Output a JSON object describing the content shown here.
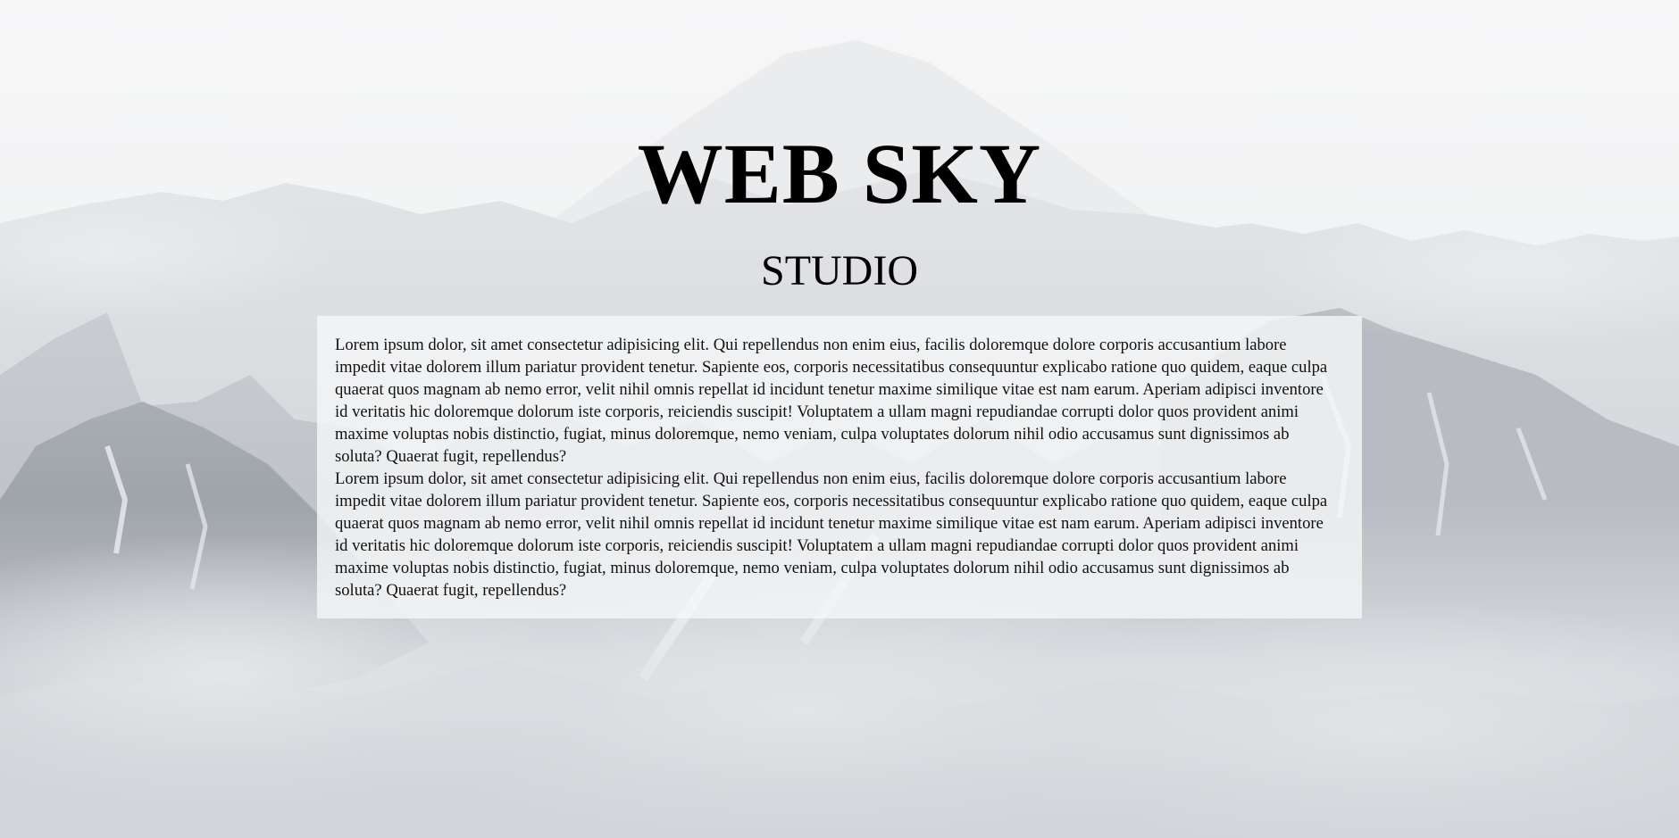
{
  "hero": {
    "title": "WEB SKY",
    "subtitle": "STUDIO"
  },
  "content": {
    "paragraphs": [
      "Lorem ipsum dolor, sit amet consectetur adipisicing elit. Qui repellendus non enim eius, facilis doloremque dolore corporis accusantium labore impedit vitae dolorem illum pariatur provident tenetur. Sapiente eos, corporis necessitatibus consequuntur explicabo ratione quo quidem, eaque culpa quaerat quos magnam ab nemo error, velit nihil omnis repellat id incidunt tenetur maxime similique vitae est nam earum. Aperiam adipisci inventore id veritatis hic doloremque dolorum iste corporis, reiciendis suscipit! Voluptatem a ullam magni repudiandae corrupti dolor quos provident animi maxime voluptas nobis distinctio, fugiat, minus doloremque, nemo veniam, culpa voluptates dolorum nihil odio accusamus sunt dignissimos ab soluta? Quaerat fugit, repellendus?",
      "Lorem ipsum dolor, sit amet consectetur adipisicing elit. Qui repellendus non enim eius, facilis doloremque dolore corporis accusantium labore impedit vitae dolorem illum pariatur provident tenetur. Sapiente eos, corporis necessitatibus consequuntur explicabo ratione quo quidem, eaque culpa quaerat quos magnam ab nemo error, velit nihil omnis repellat id incidunt tenetur maxime similique vitae est nam earum. Aperiam adipisci inventore id veritatis hic doloremque dolorum iste corporis, reiciendis suscipit! Voluptatem a ullam magni repudiandae corrupti dolor quos provident animi maxime voluptas nobis distinctio, fugiat, minus doloremque, nemo veniam, culpa voluptates dolorum nihil odio accusamus sunt dignissimos ab soluta? Quaerat fugit, repellendus?"
    ]
  },
  "background": {
    "subject": "misty-snowy-mountains",
    "sky_color": "#f4f4f5",
    "mountain_light": "#d7dade",
    "mountain_mid": "#b9bdc3",
    "mountain_dark": "#8f949b",
    "fog_color": "#eef0f2"
  }
}
